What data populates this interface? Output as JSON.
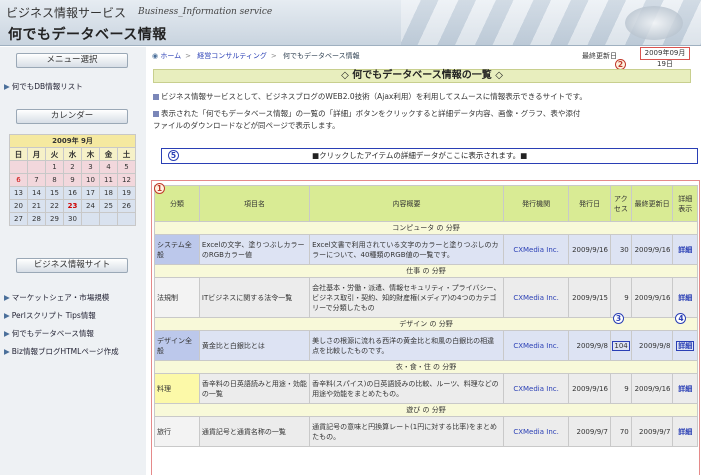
{
  "header": {
    "site_title": "ビジネス情報サービス",
    "site_subtitle": "Business_Information service",
    "page_title": "何でもデータベース情報"
  },
  "sidebar": {
    "menu_head": "メニュー選択",
    "menu_link": "何でもDB情報リスト",
    "calendar_head": "カレンダー",
    "calendar": {
      "title": "2009年 9月",
      "dow": [
        "日",
        "月",
        "火",
        "水",
        "木",
        "金",
        "土"
      ],
      "weeks": [
        [
          "",
          "",
          "1",
          "2",
          "3",
          "4",
          "5"
        ],
        [
          "6",
          "7",
          "8",
          "9",
          "10",
          "11",
          "12"
        ],
        [
          "13",
          "14",
          "15",
          "16",
          "17",
          "18",
          "19"
        ],
        [
          "20",
          "21",
          "22",
          "23",
          "24",
          "25",
          "26"
        ],
        [
          "27",
          "28",
          "29",
          "30",
          "",
          "",
          ""
        ]
      ]
    },
    "sites_head": "ビジネス情報サイト",
    "site_links": [
      "マーケットシェア・市場規模",
      "Perlスクリプト Tips情報",
      "何でもデータベース情報",
      "Biz情報ブログHTMLページ作成"
    ]
  },
  "main": {
    "breadcrumb": [
      "ホーム",
      "経営コンサルティング",
      "何でもデータベース情報"
    ],
    "updated_label": "最終更新日",
    "updated_date": "2009年09月19日",
    "banner": "◇ 何でもデータベース情報の一覧 ◇",
    "desc1": "ビジネス情報サービスとして、ビジネスブログのWEB2.0技術（Ajax利用）を利用してスムースに情報表示できるサイトです。",
    "desc2a": "表示された「何でもデータベース情報」の一覧の「詳細」ボタンをクリックすると詳細データ内容、画像・グラフ、表や添付",
    "desc2b": "ファイルのダウンロードなどが同ページで表示します。",
    "detail_text": "■クリックしたアイテムの詳細データがここに表示されます。■",
    "markers": {
      "m1": "1",
      "m2": "2",
      "m3": "3",
      "m4": "4",
      "m5": "5"
    },
    "table": {
      "headers": [
        "分類",
        "項目名",
        "内容概要",
        "発行機関",
        "発行日",
        "アクセス",
        "最終更新日",
        "詳細表示"
      ],
      "rows": [
        {
          "cat": "コンピュータ の 分野"
        },
        {
          "group": "システム全般",
          "item": "Excelの文字、塗りつぶしカラーのRGBカラー値",
          "summary": "Excel文書で利用されている文字のカラーと塗りつぶしのカラーについて、40種類のRGB値の一覧です。",
          "pub": "CXMedia Inc.",
          "date": "2009/9/16",
          "access": "30",
          "updated": "2009/9/16",
          "link": "詳細"
        },
        {
          "cat": "仕事 の 分野"
        },
        {
          "group": "法規制",
          "item": "ITビジネスに関する法令一覧",
          "summary": "会社基本・労働・派遣、情報セキュリティ・プライバシー、ビジネス取引・契約、知的財産権(メディア)の4つのカテゴリーで分類したもの",
          "pub": "CXMedia Inc.",
          "date": "2009/9/15",
          "access": "9",
          "updated": "2009/9/16",
          "link": "詳細"
        },
        {
          "cat": "デザイン の 分野"
        },
        {
          "group": "デザイン全般",
          "item": "黄金比と白銀比とは",
          "summary": "美しさの根源に流れる西洋の黄金比と和風の白銀比の相違点を比較したものです。",
          "pub": "CXMedia Inc.",
          "date": "2009/9/8",
          "access": "104",
          "updated": "2009/9/8",
          "link": "詳細"
        },
        {
          "cat": "衣・食・住 の 分野"
        },
        {
          "group": "料理",
          "item": "香辛料の日英語読みと用途・効能の一覧",
          "summary": "香辛料(スパイス)の日英語読みの比較、ルーツ、料理などの用途や効能をまとめたもの。",
          "pub": "CXMedia Inc.",
          "date": "2009/9/16",
          "access": "9",
          "updated": "2009/9/16",
          "link": "詳細"
        },
        {
          "cat": "遊び の 分野"
        },
        {
          "group": "旅行",
          "item": "通貨記号と通貨名称の一覧",
          "summary": "通貨記号の意味と円換算レート(1円に対する比率)をまとめたもの。",
          "pub": "CXMedia Inc.",
          "date": "2009/9/7",
          "access": "70",
          "updated": "2009/9/7",
          "link": "詳細"
        }
      ]
    }
  }
}
